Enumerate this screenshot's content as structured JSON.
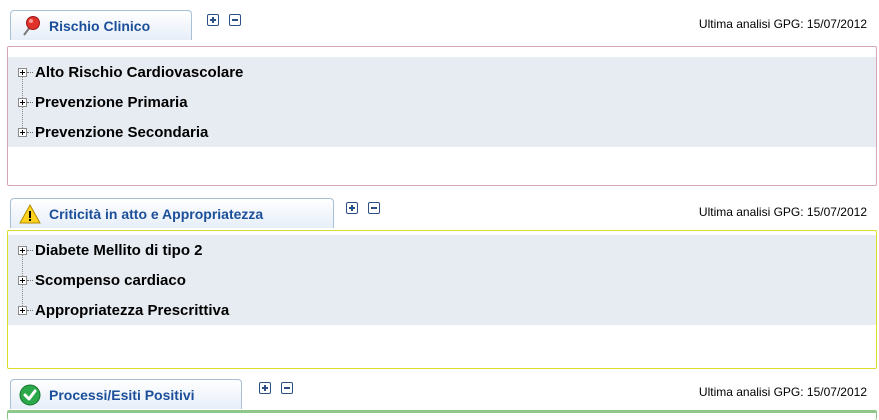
{
  "colors": {
    "tab_text": "#1c4f9a",
    "row_background": "#e7ecf3",
    "rischio_border": "#d9a6b6",
    "criticita_border": "#dcdc2a",
    "processi_border": "#8fc68a"
  },
  "panels": [
    {
      "title": "Rischio Clinico",
      "icon": "pushpin-icon",
      "expand_all": "expand-all",
      "collapse_all": "collapse-all",
      "last_analysis": "Ultima analisi GPG: 15/07/2012",
      "items": [
        "Alto Rischio Cardiovascolare",
        "Prevenzione Primaria",
        "Prevenzione Secondaria"
      ]
    },
    {
      "title": "Criticità in atto e Appropriatezza",
      "icon": "warning-icon",
      "last_analysis": "Ultima analisi GPG: 15/07/2012",
      "items": [
        "Diabete Mellito di tipo 2",
        "Scompenso cardiaco",
        "Appropriatezza Prescrittiva"
      ]
    },
    {
      "title": "Processi/Esiti Positivi",
      "icon": "check-circle-icon",
      "last_analysis": "Ultima analisi GPG: 15/07/2012",
      "items": []
    }
  ]
}
